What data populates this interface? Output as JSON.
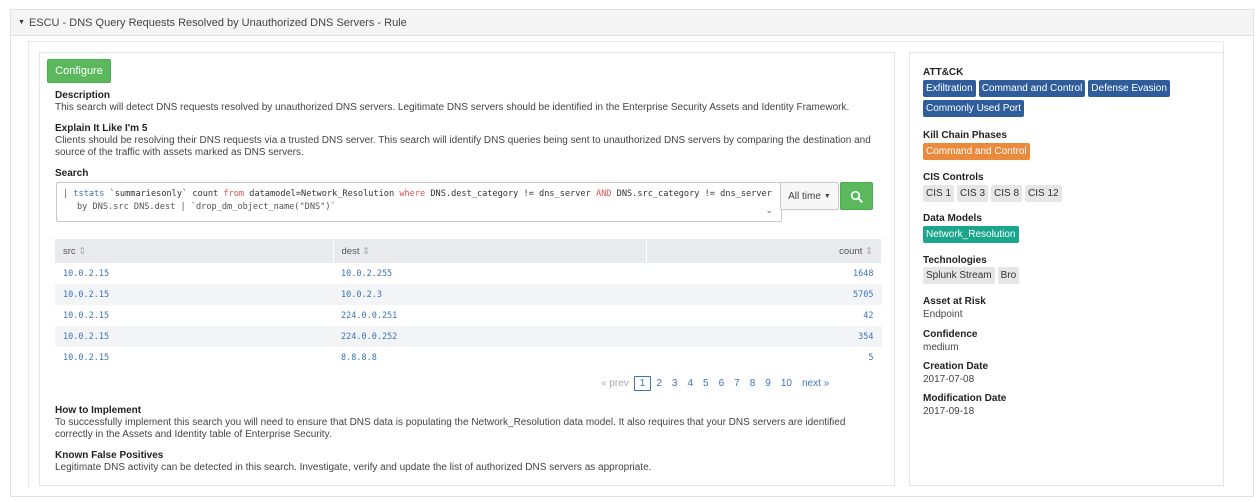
{
  "header": {
    "title": "ESCU - DNS Query Requests Resolved by Unauthorized DNS Servers - Rule"
  },
  "left": {
    "configure_label": "Configure",
    "description_title": "Description",
    "description_text": "This search will detect DNS requests resolved by unauthorized DNS servers. Legitimate DNS servers should be identified in the Enterprise Security Assets and Identity Framework.",
    "eli5_title": "Explain It Like I'm 5",
    "eli5_text": "Clients should be resolving their DNS requests via a trusted DNS server. This search will identify DNS queries being sent to unauthorized DNS servers by comparing the destination and source of the traffic with assets marked as DNS servers.",
    "search_title": "Search",
    "search_line1_parts": [
      "| ",
      "tstats",
      " `summariesonly` count ",
      "from",
      " datamodel=Network_Resolution ",
      "where",
      " DNS.dest_category != dns_server ",
      "AND",
      " DNS.src_category != dns_server"
    ],
    "search_line2": "by DNS.src DNS.dest | `drop_dm_object_name(\"DNS\")`",
    "time_label": "All time",
    "table": {
      "headers": [
        "src",
        "dest",
        "count"
      ],
      "rows": [
        [
          "10.0.2.15",
          "10.0.2.255",
          "1648"
        ],
        [
          "10.0.2.15",
          "10.0.2.3",
          "5705"
        ],
        [
          "10.0.2.15",
          "224.0.0.251",
          "42"
        ],
        [
          "10.0.2.15",
          "224.0.0.252",
          "354"
        ],
        [
          "10.0.2.15",
          "8.8.8.8",
          "5"
        ]
      ]
    },
    "pager": {
      "prev": "« prev",
      "pages": [
        "1",
        "2",
        "3",
        "4",
        "5",
        "6",
        "7",
        "8",
        "9",
        "10"
      ],
      "current": "1",
      "next": "next »"
    },
    "how_title": "How to Implement",
    "how_text": "To successfully implement this search you will need to ensure that DNS data is populating the Network_Resolution data model. It also requires that your DNS servers are identified correctly in the Assets and Identity table of Enterprise Security.",
    "fp_title": "Known False Positives",
    "fp_text": "Legitimate DNS activity can be detected in this search. Investigate, verify and update the list of authorized DNS servers as appropriate."
  },
  "right": {
    "attack_title": "ATT&CK",
    "attack_tags": [
      "Exfiltration",
      "Command and Control",
      "Defense Evasion",
      "Commonly Used Port"
    ],
    "kill_chain_title": "Kill Chain Phases",
    "kill_chain_tags": [
      "Command and Control"
    ],
    "cis_title": "CIS Controls",
    "cis_tags": [
      "CIS 1",
      "CIS 3",
      "CIS 8",
      "CIS 12"
    ],
    "data_models_title": "Data Models",
    "data_models_tags": [
      "Network_Resolution"
    ],
    "tech_title": "Technologies",
    "tech_tags": [
      "Splunk Stream",
      "Bro"
    ],
    "asset_title": "Asset at Risk",
    "asset_value": "Endpoint",
    "confidence_title": "Confidence",
    "confidence_value": "medium",
    "creation_title": "Creation Date",
    "creation_value": "2017-07-08",
    "modification_title": "Modification Date",
    "modification_value": "2017-09-18"
  },
  "colors": {
    "accent_green": "#5cb85c",
    "tag_blue": "#2f5d9b",
    "tag_orange": "#e98a3d",
    "tag_teal": "#1aa68c",
    "link": "#3b73b9"
  }
}
